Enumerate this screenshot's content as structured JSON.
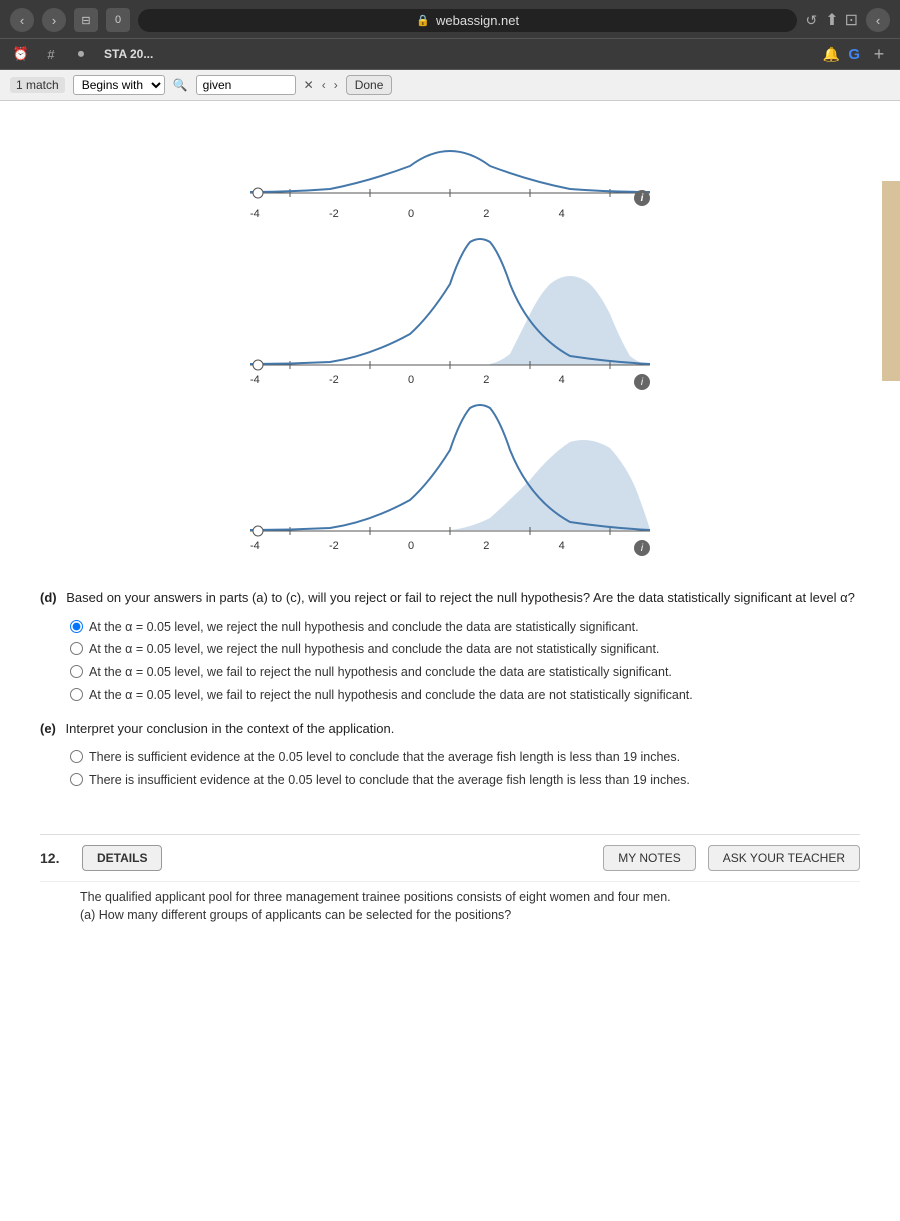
{
  "browser": {
    "url": "webassign.net",
    "tab_title": "STA 20...",
    "back_label": "‹",
    "forward_label": "›",
    "reload_label": "↺",
    "share_label": "↑",
    "new_tab_label": "⊡",
    "lock_icon": "🔒"
  },
  "toolbar": {
    "clock_icon": "⏰",
    "grid_icon": "⊞",
    "record_icon": "⏺",
    "sta_label": "STA 20...",
    "notification_icon": "🔔",
    "google_icon": "G",
    "plus_icon": "+"
  },
  "find_bar": {
    "match_count": "1 match",
    "begins_with_label": "Begins with",
    "search_placeholder": "given",
    "prev_label": "‹",
    "next_label": "›",
    "done_label": "Done"
  },
  "curves": [
    {
      "id": "curve1",
      "axis_labels": [
        "-4",
        "-2",
        "0",
        "2",
        "4"
      ],
      "shaded": false
    },
    {
      "id": "curve2",
      "axis_labels": [
        "-4",
        "-2",
        "0",
        "2",
        "4"
      ],
      "shaded": true,
      "shade_region": "right_tail"
    },
    {
      "id": "curve3",
      "axis_labels": [
        "-4",
        "-2",
        "0",
        "2",
        "4"
      ],
      "shaded": true,
      "shade_region": "right_tail_wide"
    }
  ],
  "question_d": {
    "part_label": "(d)",
    "text": "Based on your answers in parts (a) to (c), will you reject or fail to reject the null hypothesis? Are the data statistically significant at level α?",
    "options": [
      "At the α = 0.05 level, we reject the null hypothesis and conclude the data are statistically significant.",
      "At the α = 0.05 level, we reject the null hypothesis and conclude the data are not statistically significant.",
      "At the α = 0.05 level, we fail to reject the null hypothesis and conclude the data are statistically significant.",
      "At the α = 0.05 level, we fail to reject the null hypothesis and conclude the data are not statistically significant."
    ],
    "selected_index": 0
  },
  "question_e": {
    "part_label": "(e)",
    "text": "Interpret your conclusion in the context of the application.",
    "options": [
      "There is sufficient evidence at the 0.05 level to conclude that the average fish length is less than 19 inches.",
      "There is insufficient evidence at the 0.05 level to conclude that the average fish length is less than 19 inches."
    ],
    "selected_index": -1
  },
  "bottom_bar": {
    "question_num": "12.",
    "details_label": "DETAILS",
    "my_notes_label": "MY NOTES",
    "ask_teacher_label": "ASK YOUR TEACHER"
  },
  "next_question": {
    "text": "The qualified applicant pool for three management trainee positions consists of eight women and four men.",
    "sub_text": "(a) How many different groups of applicants can be selected for the positions?"
  }
}
